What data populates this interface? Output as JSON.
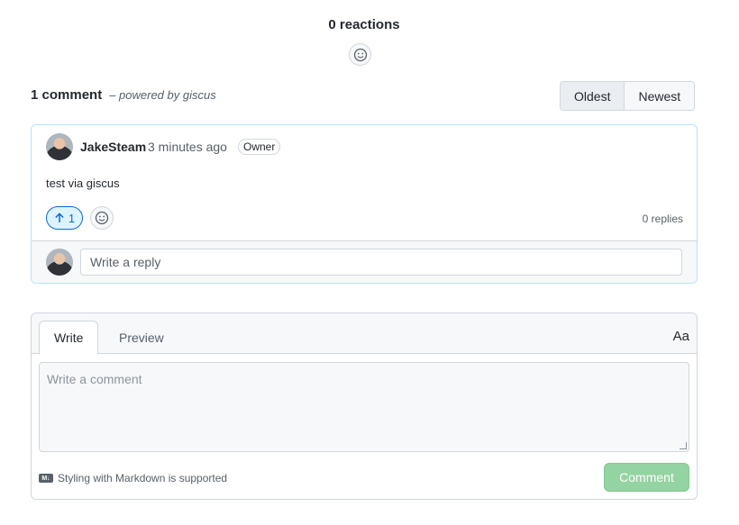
{
  "reactions": {
    "title": "0 reactions"
  },
  "comments_header": {
    "count": "1 comment",
    "powered_by": "– powered by giscus",
    "sort_options": [
      "Oldest",
      "Newest"
    ],
    "active_sort": "Oldest"
  },
  "comment": {
    "author": "JakeSteam",
    "time": "3 minutes ago",
    "badge": "Owner",
    "body": "test via giscus",
    "upvotes": "1",
    "replies": "0 replies",
    "reply_placeholder": "Write a reply"
  },
  "editor": {
    "tabs": [
      "Write",
      "Preview"
    ],
    "active_tab": "Write",
    "font_toggle": "Aa",
    "placeholder": "Write a comment",
    "markdown_note": "Styling with Markdown is supported",
    "markdown_icon_text": "M↓",
    "submit_label": "Comment"
  },
  "colors": {
    "accent": "#0969da",
    "submit_disabled": "#94d3a2",
    "comment_border": "#b6e3ff"
  },
  "icons": [
    "smiley-icon",
    "arrow-up-icon",
    "markdown-icon",
    "avatar"
  ]
}
